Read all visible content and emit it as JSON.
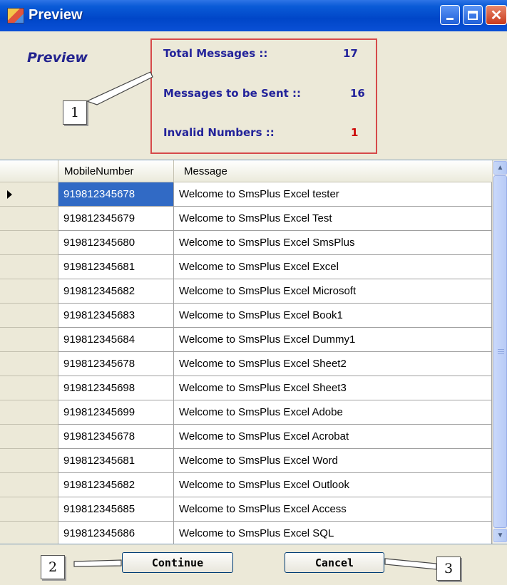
{
  "window": {
    "title": "Preview"
  },
  "preview_label": "Preview",
  "stats": {
    "total_label": "Total Messages ::",
    "total_value": "17",
    "sent_label": "Messages to be Sent ::",
    "sent_value": "16",
    "invalid_label": "Invalid Numbers ::",
    "invalid_value": "1"
  },
  "colors": {
    "stat_text": "#23239a",
    "invalid_value": "#cc0000",
    "stats_border": "#d64a4a",
    "selection": "#316ac5"
  },
  "callouts": [
    "1",
    "2",
    "3"
  ],
  "grid": {
    "columns": [
      "MobileNumber",
      "Message"
    ],
    "selected_row": 0,
    "rows": [
      [
        "919812345678",
        "Welcome to SmsPlus Excel tester"
      ],
      [
        "919812345679",
        "Welcome to SmsPlus Excel Test"
      ],
      [
        "919812345680",
        "Welcome to SmsPlus Excel SmsPlus"
      ],
      [
        "919812345681",
        "Welcome to SmsPlus Excel Excel"
      ],
      [
        "919812345682",
        "Welcome to SmsPlus Excel Microsoft"
      ],
      [
        "919812345683",
        "Welcome to SmsPlus Excel Book1"
      ],
      [
        "919812345684",
        "Welcome to SmsPlus Excel Dummy1"
      ],
      [
        "919812345678",
        "Welcome to SmsPlus Excel Sheet2"
      ],
      [
        "919812345698",
        "Welcome to SmsPlus Excel Sheet3"
      ],
      [
        "919812345699",
        "Welcome to SmsPlus Excel Adobe"
      ],
      [
        "919812345678",
        "Welcome to SmsPlus Excel Acrobat"
      ],
      [
        "919812345681",
        "Welcome to SmsPlus Excel Word"
      ],
      [
        "919812345682",
        "Welcome to SmsPlus Excel Outlook"
      ],
      [
        "919812345685",
        "Welcome to SmsPlus Excel Access"
      ],
      [
        "919812345686",
        "Welcome to SmsPlus Excel SQL"
      ]
    ]
  },
  "buttons": {
    "continue": "Continue",
    "cancel": "Cancel"
  },
  "icons": {
    "app": "app-window-icon",
    "minimize": "minimize-icon",
    "maximize": "maximize-icon",
    "close": "close-icon",
    "row_pointer": "row-pointer-icon",
    "scroll_up": "scroll-up-icon",
    "scroll_down": "scroll-down-icon"
  }
}
